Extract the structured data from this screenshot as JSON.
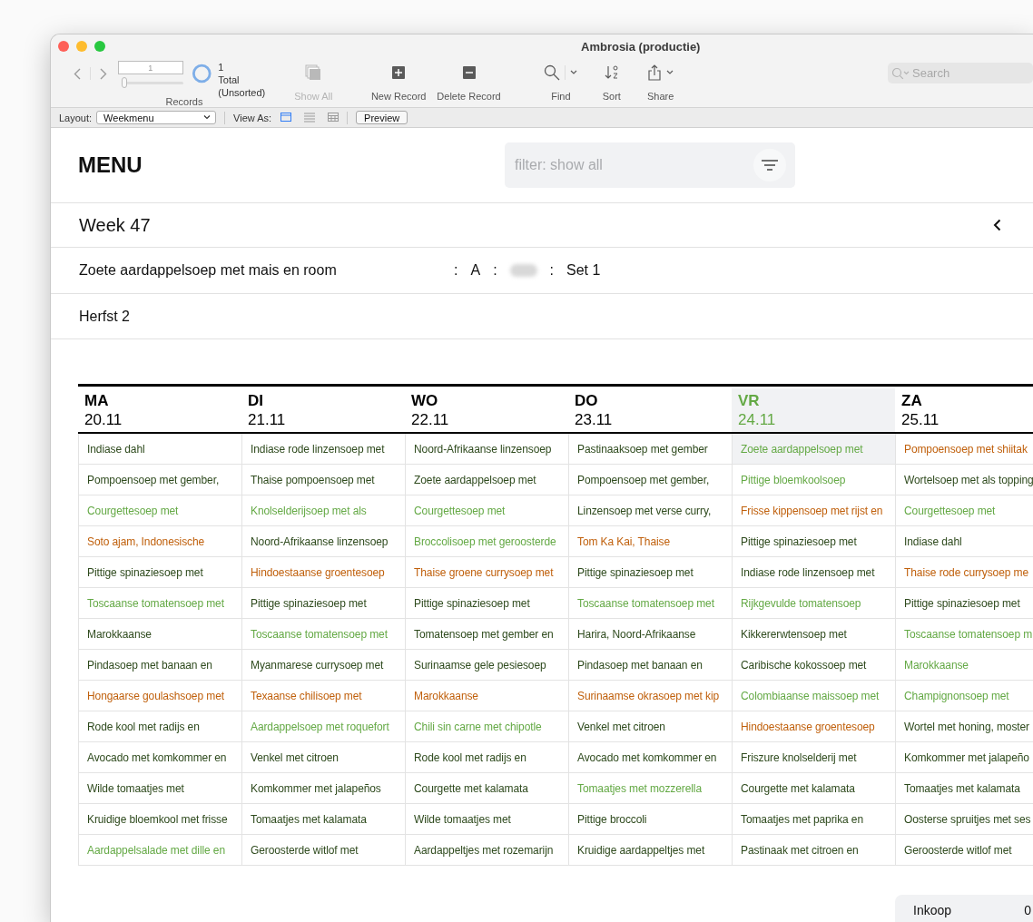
{
  "window": {
    "title": "Ambrosia (productie)"
  },
  "toolbar": {
    "record_field": {
      "value": "1"
    },
    "record_slider": {
      "level": 0
    },
    "record_count": "1",
    "record_status": "Total (Unsorted)",
    "records_label": "Records",
    "buttons": [
      {
        "kind": "show_all",
        "label": "Show All",
        "disabled": true
      },
      {
        "kind": "new_record",
        "label": "New Record",
        "disabled": false
      },
      {
        "kind": "delete_record",
        "label": "Delete Record",
        "disabled": false
      },
      {
        "kind": "find",
        "label": "Find",
        "disabled": false
      },
      {
        "kind": "sort",
        "label": "Sort",
        "disabled": false
      },
      {
        "kind": "share",
        "label": "Share",
        "disabled": false
      }
    ],
    "search": {
      "placeholder": "Search"
    }
  },
  "layout_bar": {
    "layout_label": "Layout:",
    "layout_value": "Weekmenu",
    "view_as_label": "View As:",
    "view_modes": [
      {
        "kind": "form",
        "selected": true
      },
      {
        "kind": "list",
        "selected": false
      },
      {
        "kind": "table",
        "selected": false
      }
    ],
    "preview_button": "Preview"
  },
  "page": {
    "title": "MENU",
    "filter": {
      "placeholder": "filter: show all"
    },
    "week": "Week 47",
    "dish_line": {
      "name": "Zoete aardappelsoep met mais en room",
      "parts": [
        {
          "kind": "separator",
          "text": ":"
        },
        {
          "kind": "value",
          "text": "A"
        },
        {
          "kind": "separator",
          "text": ":"
        },
        {
          "kind": "blurred"
        },
        {
          "kind": "separator",
          "text": ":"
        },
        {
          "kind": "value",
          "text": "Set 1"
        }
      ]
    },
    "season": "Herfst 2"
  },
  "days": [
    {
      "day": "MA",
      "date": "20.11",
      "selected": false,
      "dishes": [
        {
          "name": "Indiase dahl",
          "color": "#2e4a1d",
          "selected": false
        },
        {
          "name": "Pompoensoep met gember,",
          "color": "#2e4a1d",
          "selected": false
        },
        {
          "name": "Courgettesoep met",
          "color": "#64a945",
          "selected": false
        },
        {
          "name": "Soto ajam, Indonesische",
          "color": "#c0600c",
          "selected": false
        },
        {
          "name": "Pittige spinaziesoep met",
          "color": "#2e4a1d",
          "selected": false
        },
        {
          "name": "Toscaanse tomatensoep met",
          "color": "#64a945",
          "selected": false
        },
        {
          "name": "Marokkaanse",
          "color": "#2e4a1d",
          "selected": false
        },
        {
          "name": "Pindasoep met banaan en",
          "color": "#2e4a1d",
          "selected": false
        },
        {
          "name": "Hongaarse goulashsoep met",
          "color": "#c0600c",
          "selected": false
        },
        {
          "name": "Rode kool met radijs en",
          "color": "#2e4a1d",
          "selected": false
        },
        {
          "name": "Avocado met komkommer en",
          "color": "#2e4a1d",
          "selected": false
        },
        {
          "name": "Wilde tomaatjes met",
          "color": "#2e4a1d",
          "selected": false
        },
        {
          "name": "Kruidige bloemkool met frisse",
          "color": "#2e4a1d",
          "selected": false
        },
        {
          "name": "Aardappelsalade met dille en",
          "color": "#64a945",
          "selected": false
        }
      ]
    },
    {
      "day": "DI",
      "date": "21.11",
      "selected": false,
      "dishes": [
        {
          "name": "Indiase rode linzensoep met",
          "color": "#2e4a1d",
          "selected": false
        },
        {
          "name": "Thaise pompoensoep met",
          "color": "#2e4a1d",
          "selected": false
        },
        {
          "name": "Knolselderijsoep met als",
          "color": "#64a945",
          "selected": false
        },
        {
          "name": "Noord-Afrikaanse linzensoep",
          "color": "#2e4a1d",
          "selected": false
        },
        {
          "name": "Hindoestaanse groentesoep",
          "color": "#c0600c",
          "selected": false
        },
        {
          "name": "Pittige spinaziesoep met",
          "color": "#2e4a1d",
          "selected": false
        },
        {
          "name": "Toscaanse tomatensoep met",
          "color": "#64a945",
          "selected": false
        },
        {
          "name": "Myanmarese currysoep met",
          "color": "#2e4a1d",
          "selected": false
        },
        {
          "name": "Texaanse chilisoep met",
          "color": "#c0600c",
          "selected": false
        },
        {
          "name": "Aardappelsoep met roquefort",
          "color": "#64a945",
          "selected": false
        },
        {
          "name": "Venkel met citroen",
          "color": "#2e4a1d",
          "selected": false
        },
        {
          "name": "Komkommer met jalapeños",
          "color": "#2e4a1d",
          "selected": false
        },
        {
          "name": "Tomaatjes met kalamata",
          "color": "#2e4a1d",
          "selected": false
        },
        {
          "name": "Geroosterde witlof met",
          "color": "#2e4a1d",
          "selected": false
        }
      ]
    },
    {
      "day": "WO",
      "date": "22.11",
      "selected": false,
      "dishes": [
        {
          "name": "Noord-Afrikaanse linzensoep",
          "color": "#2e4a1d",
          "selected": false
        },
        {
          "name": "Zoete aardappelsoep met",
          "color": "#2e4a1d",
          "selected": false
        },
        {
          "name": "Courgettesoep met",
          "color": "#64a945",
          "selected": false
        },
        {
          "name": "Broccolisoep met geroosterde",
          "color": "#64a945",
          "selected": false
        },
        {
          "name": "Thaise groene currysoep met",
          "color": "#c0600c",
          "selected": false
        },
        {
          "name": "Pittige spinaziesoep met",
          "color": "#2e4a1d",
          "selected": false
        },
        {
          "name": "Tomatensoep met gember en",
          "color": "#2e4a1d",
          "selected": false
        },
        {
          "name": "Surinaamse gele pesiesoep",
          "color": "#2e4a1d",
          "selected": false
        },
        {
          "name": "Marokkaanse",
          "color": "#c0600c",
          "selected": false
        },
        {
          "name": "Chili sin carne met chipotle",
          "color": "#64a945",
          "selected": false
        },
        {
          "name": "Rode kool met radijs en",
          "color": "#2e4a1d",
          "selected": false
        },
        {
          "name": "Courgette met kalamata",
          "color": "#2e4a1d",
          "selected": false
        },
        {
          "name": "Wilde tomaatjes met",
          "color": "#2e4a1d",
          "selected": false
        },
        {
          "name": "Aardappeltjes met rozemarijn",
          "color": "#2e4a1d",
          "selected": false
        }
      ]
    },
    {
      "day": "DO",
      "date": "23.11",
      "selected": false,
      "dishes": [
        {
          "name": "Pastinaaksoep met gember",
          "color": "#2e4a1d",
          "selected": false
        },
        {
          "name": "Pompoensoep met gember,",
          "color": "#2e4a1d",
          "selected": false
        },
        {
          "name": "Linzensoep met verse curry,",
          "color": "#2e4a1d",
          "selected": false
        },
        {
          "name": "Tom Ka Kai, Thaise",
          "color": "#c0600c",
          "selected": false
        },
        {
          "name": "Pittige spinaziesoep met",
          "color": "#2e4a1d",
          "selected": false
        },
        {
          "name": "Toscaanse tomatensoep met",
          "color": "#64a945",
          "selected": false
        },
        {
          "name": "Harira, Noord-Afrikaanse",
          "color": "#2e4a1d",
          "selected": false
        },
        {
          "name": "Pindasoep met banaan en",
          "color": "#2e4a1d",
          "selected": false
        },
        {
          "name": "Surinaamse okrasoep met kip",
          "color": "#c0600c",
          "selected": false
        },
        {
          "name": "Venkel met citroen",
          "color": "#2e4a1d",
          "selected": false
        },
        {
          "name": "Avocado met komkommer en",
          "color": "#2e4a1d",
          "selected": false
        },
        {
          "name": "Tomaatjes met mozzerella",
          "color": "#64a945",
          "selected": false
        },
        {
          "name": "Pittige broccoli",
          "color": "#2e4a1d",
          "selected": false
        },
        {
          "name": "Kruidige aardappeltjes met",
          "color": "#2e4a1d",
          "selected": false
        }
      ]
    },
    {
      "day": "VR",
      "date": "24.11",
      "selected": true,
      "dishes": [
        {
          "name": "Zoete aardappelsoep met",
          "color": "#64a945",
          "selected": true
        },
        {
          "name": "Pittige bloemkoolsoep",
          "color": "#64a945",
          "selected": false
        },
        {
          "name": "Frisse kippensoep met rijst en",
          "color": "#c0600c",
          "selected": false
        },
        {
          "name": "Pittige spinaziesoep met",
          "color": "#2e4a1d",
          "selected": false
        },
        {
          "name": "Indiase rode linzensoep met",
          "color": "#2e4a1d",
          "selected": false
        },
        {
          "name": "Rijkgevulde tomatensoep",
          "color": "#64a945",
          "selected": false
        },
        {
          "name": "Kikkererwtensoep met",
          "color": "#2e4a1d",
          "selected": false
        },
        {
          "name": "Caribische kokossoep met",
          "color": "#2e4a1d",
          "selected": false
        },
        {
          "name": "Colombiaanse maissoep met",
          "color": "#64a945",
          "selected": false
        },
        {
          "name": "Hindoestaanse groentesoep",
          "color": "#c0600c",
          "selected": false
        },
        {
          "name": "Friszure knolselderij met",
          "color": "#2e4a1d",
          "selected": false
        },
        {
          "name": "Courgette met kalamata",
          "color": "#2e4a1d",
          "selected": false
        },
        {
          "name": "Tomaatjes met paprika en",
          "color": "#2e4a1d",
          "selected": false
        },
        {
          "name": "Pastinaak met citroen en",
          "color": "#2e4a1d",
          "selected": false
        }
      ]
    },
    {
      "day": "ZA",
      "date": "25.11",
      "selected": false,
      "dishes": [
        {
          "name": "Pompoensoep met shiitak",
          "color": "#c0600c",
          "selected": false
        },
        {
          "name": "Wortelsoep met als topping",
          "color": "#2e4a1d",
          "selected": false
        },
        {
          "name": "Courgettesoep met",
          "color": "#64a945",
          "selected": false
        },
        {
          "name": "Indiase dahl",
          "color": "#2e4a1d",
          "selected": false
        },
        {
          "name": "Thaise rode currysoep me",
          "color": "#c0600c",
          "selected": false
        },
        {
          "name": "Pittige spinaziesoep met",
          "color": "#2e4a1d",
          "selected": false
        },
        {
          "name": "Toscaanse tomatensoep m",
          "color": "#64a945",
          "selected": false
        },
        {
          "name": "Marokkaanse",
          "color": "#64a945",
          "selected": false
        },
        {
          "name": "Champignonsoep met",
          "color": "#64a945",
          "selected": false
        },
        {
          "name": "Wortel met honing, moster",
          "color": "#2e4a1d",
          "selected": false
        },
        {
          "name": "Komkommer met jalapeño",
          "color": "#2e4a1d",
          "selected": false
        },
        {
          "name": "Tomaatjes met kalamata",
          "color": "#2e4a1d",
          "selected": false
        },
        {
          "name": "Oosterse spruitjes met ses",
          "color": "#2e4a1d",
          "selected": false
        },
        {
          "name": "Geroosterde witlof met",
          "color": "#2e4a1d",
          "selected": false
        }
      ]
    }
  ],
  "summary_card": {
    "label": "Inkoop",
    "value": "0"
  }
}
